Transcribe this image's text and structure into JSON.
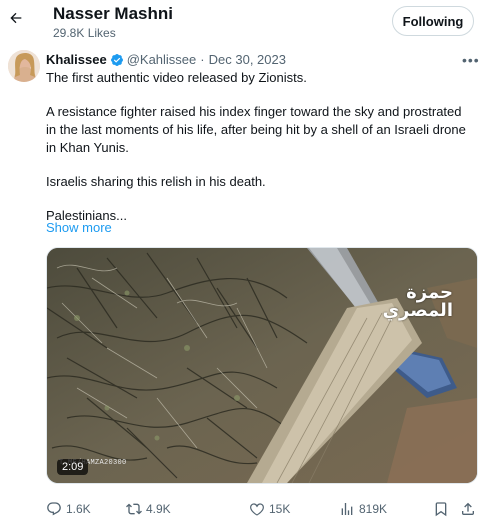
{
  "header": {
    "title": "Nasser Mashni",
    "subtitle": "29.8K Likes",
    "follow_label": "Following"
  },
  "tweet": {
    "author_name": "Khalissee",
    "handle": "@Kahlissee",
    "separator": "·",
    "date": "Dec 30, 2023",
    "paragraphs": [
      "The first authentic video released by Zionists.",
      "A resistance fighter raised his index finger toward the sky and prostrated in the last moments of his life, after being hit by a shell of an Israeli drone in Khan Yunis.",
      "Israelis sharing this relish in his death.",
      "Palestinians..."
    ],
    "show_more": "Show more",
    "more_icon": "•••"
  },
  "media": {
    "duration": "2:09",
    "watermark_handle": "T.ME/HAMZA20300",
    "watermark_logo_line1": "حمزة",
    "watermark_logo_line2": "المصري"
  },
  "actions": {
    "replies": "1.6K",
    "reposts": "4.9K",
    "likes": "15K",
    "views": "819K"
  },
  "colors": {
    "accent": "#1d9bf0",
    "text_secondary": "#536471",
    "verified": "#1d9bf0"
  }
}
